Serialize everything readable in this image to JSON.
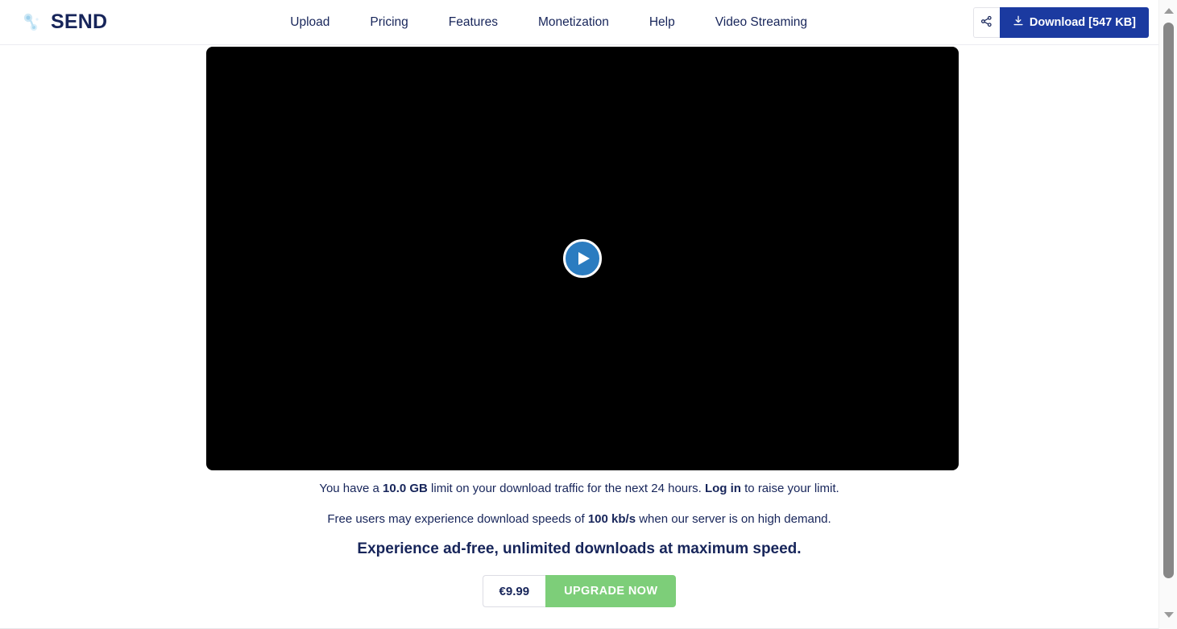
{
  "header": {
    "brand": {
      "name": "SEND",
      "logo_icon": "send-logo-icon",
      "logo_color": "#b7dcf0"
    },
    "nav": [
      {
        "label": "Upload"
      },
      {
        "label": "Pricing"
      },
      {
        "label": "Features"
      },
      {
        "label": "Monetization"
      },
      {
        "label": "Help"
      },
      {
        "label": "Video Streaming"
      }
    ],
    "actions": {
      "share_icon": "share-icon",
      "download_icon": "download-icon",
      "download_label": "Download [547 KB]",
      "download_color": "#1b3aa0"
    }
  },
  "player": {
    "background_color": "#000000",
    "play_icon": "play-icon",
    "play_button_color": "#2b7cc0"
  },
  "notices": {
    "limit_prefix": "You have a ",
    "limit_value": "10.0 GB",
    "limit_middle": " limit on your download traffic for the next 24 hours. ",
    "login_label": "Log in",
    "limit_suffix": " to raise your limit.",
    "speed_prefix": "Free users may experience download speeds of ",
    "speed_value": "100 kb/s",
    "speed_suffix": " when our server is on high demand.",
    "headline": "Experience ad-free, unlimited downloads at maximum speed."
  },
  "upgrade": {
    "price": "€9.99",
    "button_label": "UPGRADE NOW",
    "button_color": "#7dce79"
  },
  "scrollbar": {
    "up_icon": "chevron-up-icon",
    "down_icon": "chevron-down-icon"
  }
}
